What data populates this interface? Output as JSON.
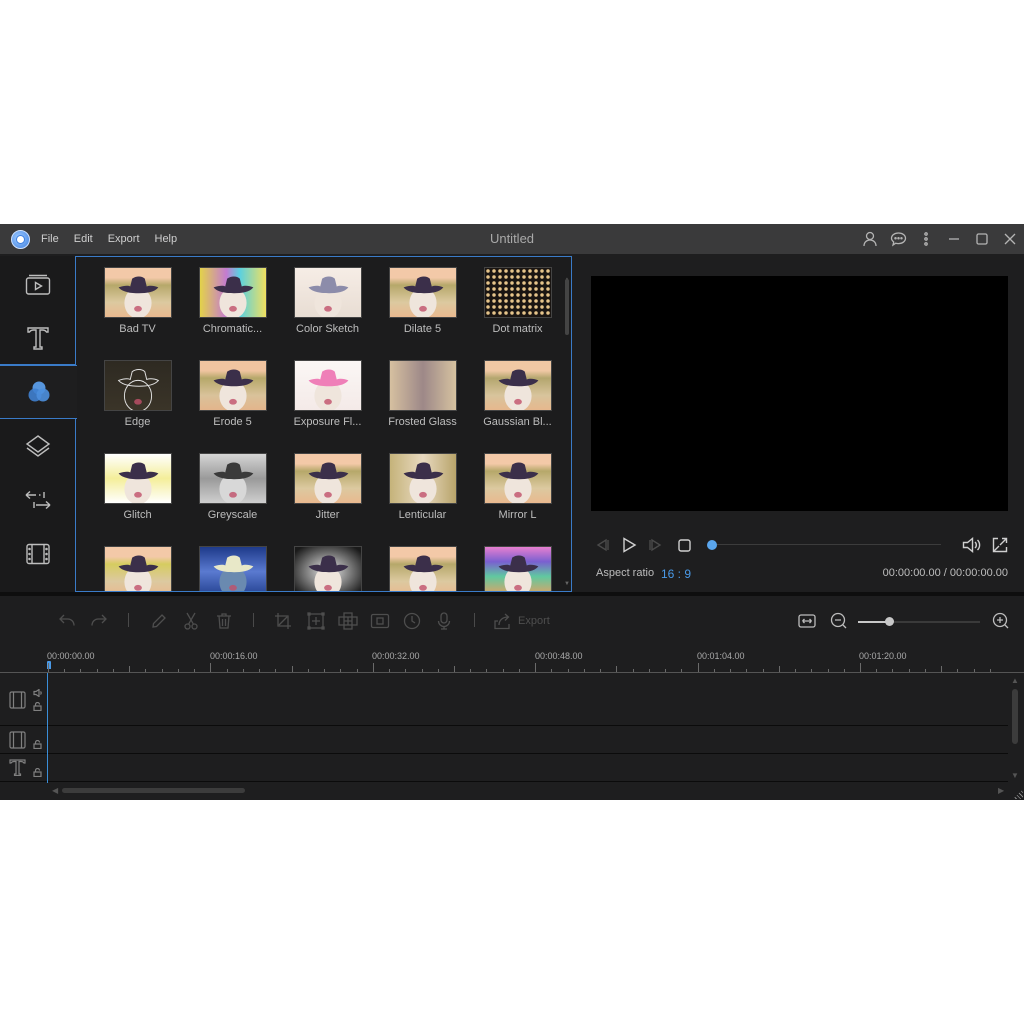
{
  "window": {
    "title": "Untitled",
    "menu": [
      "File",
      "Edit",
      "Export",
      "Help"
    ],
    "controls": [
      "account-icon",
      "feedback-icon",
      "more-icon",
      "minimize-icon",
      "maximize-icon",
      "close-icon"
    ]
  },
  "sidebar": {
    "items": [
      {
        "name": "media",
        "icon": "media-icon",
        "active": false
      },
      {
        "name": "text",
        "icon": "text-icon",
        "active": false
      },
      {
        "name": "filters",
        "icon": "filters-icon",
        "active": true
      },
      {
        "name": "overlays",
        "icon": "overlay-icon",
        "active": false
      },
      {
        "name": "transitions",
        "icon": "transition-icon",
        "active": false
      },
      {
        "name": "elements",
        "icon": "film-icon",
        "active": false
      }
    ]
  },
  "effects": {
    "items": [
      {
        "label": "Bad TV",
        "style": "badtv"
      },
      {
        "label": "Chromatic...",
        "style": "chromatic"
      },
      {
        "label": "Color Sketch",
        "style": "sketch"
      },
      {
        "label": "Dilate 5",
        "style": "dilate"
      },
      {
        "label": "Dot matrix",
        "style": "dots"
      },
      {
        "label": "Edge",
        "style": "edge"
      },
      {
        "label": "Erode 5",
        "style": "erode"
      },
      {
        "label": "Exposure Fl...",
        "style": "exposure"
      },
      {
        "label": "Frosted Glass",
        "style": "frosted"
      },
      {
        "label": "Gaussian Bl...",
        "style": "gaussian"
      },
      {
        "label": "Glitch",
        "style": "glitch"
      },
      {
        "label": "Greyscale",
        "style": "grey"
      },
      {
        "label": "Jitter",
        "style": "jitter"
      },
      {
        "label": "Lenticular",
        "style": "lenticular"
      },
      {
        "label": "Mirror L",
        "style": "mirror"
      },
      {
        "label": "",
        "style": "mirror2"
      },
      {
        "label": "",
        "style": "blue"
      },
      {
        "label": "",
        "style": "vignette"
      },
      {
        "label": "",
        "style": "mosaic"
      },
      {
        "label": "",
        "style": "rainbow"
      }
    ]
  },
  "preview": {
    "aspect_label": "Aspect ratio",
    "aspect_value": "16 : 9",
    "timecode": "00:00:00.00 / 00:00:00.00",
    "progress": 0
  },
  "toolbar": {
    "export_label": "Export",
    "zoom_level": 0.25
  },
  "timeline": {
    "ruler_labels": [
      "00:00:00.00",
      "00:00:16.00",
      "00:00:32.00",
      "00:00:48.00",
      "00:01:04.00",
      "00:01:20.00"
    ],
    "tracks": [
      "video-track",
      "pip-track",
      "text-track"
    ]
  }
}
